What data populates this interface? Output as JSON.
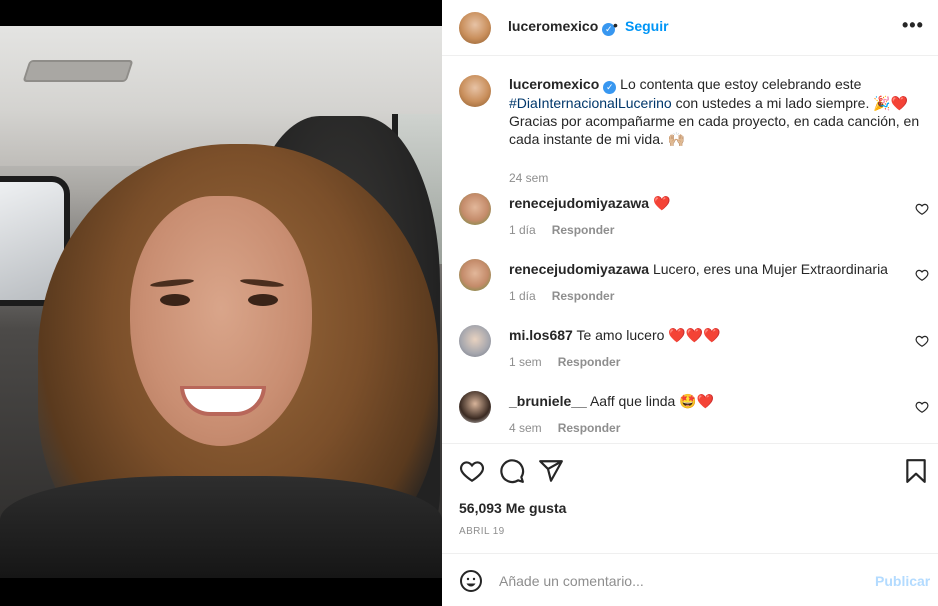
{
  "post": {
    "username": "luceromexico",
    "follow_label": "Seguir",
    "separator": "•",
    "more_label": "•••"
  },
  "caption": {
    "username": "luceromexico",
    "text_before_hashtag": "Lo contenta que estoy celebrando este",
    "hashtag": "#DiaInternacionalLucerino",
    "text_after_hashtag": "con ustedes a mi lado siempre. 🎉❤️ Gracias por acompañarme en cada proyecto, en cada canción, en cada instante de mi vida. 🙌🏼",
    "time": "24 sem"
  },
  "comments": [
    {
      "username": "renecejudomiyazawa",
      "text": "❤️",
      "time": "1 día",
      "reply_label": "Responder"
    },
    {
      "username": "renecejudomiyazawa",
      "text": "Lucero, eres una Mujer Extraordinaria",
      "time": "1 día",
      "reply_label": "Responder"
    },
    {
      "username": "mi.los687",
      "text": "Te amo lucero ❤️❤️❤️",
      "time": "1 sem",
      "reply_label": "Responder"
    },
    {
      "username": "_bruniele__",
      "text": "Aaff que linda 🤩❤️",
      "time": "4 sem",
      "reply_label": "Responder"
    }
  ],
  "actions": {
    "likes": "56,093 Me gusta",
    "date": "ABRIL 19",
    "icons": [
      "heart-icon",
      "comment-icon",
      "share-icon",
      "bookmark-icon"
    ]
  },
  "add_comment": {
    "placeholder": "Añade un comentario...",
    "post_label": "Publicar"
  },
  "colors": {
    "accent": "#0095f6",
    "verified": "#3897f0",
    "hashtag": "#00376b",
    "muted": "#8e8e8e",
    "publish_disabled": "#b3dbff"
  }
}
